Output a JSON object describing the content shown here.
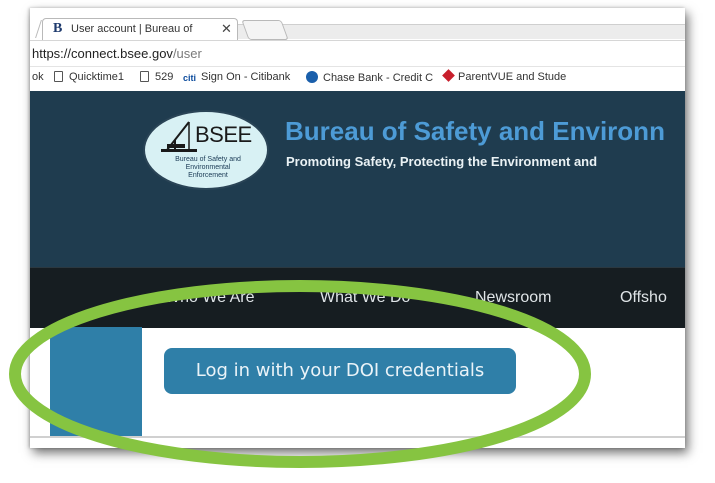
{
  "browser": {
    "tab": {
      "favicon_letter": "B",
      "title": "User account | Bureau of",
      "close_glyph": "✕"
    },
    "address": {
      "host": "https://connect.bsee.gov",
      "path": "/user"
    },
    "bookmarks": [
      {
        "label": "ok",
        "icon": "none"
      },
      {
        "label": "Quicktime1",
        "icon": "page-icon"
      },
      {
        "label": "529",
        "icon": "page-icon"
      },
      {
        "label": "Sign On - Citibank",
        "icon": "citi-icon",
        "icon_text": "citi"
      },
      {
        "label": "Chase Bank - Credit C",
        "icon": "chase-icon"
      },
      {
        "label": "ParentVUE and Stude",
        "icon": "parentvue-icon"
      }
    ]
  },
  "site": {
    "logo": {
      "acronym": "BSEE",
      "subtext_line1": "Bureau of Safety and",
      "subtext_line2": "Environmental",
      "subtext_line3": "Enforcement"
    },
    "title": "Bureau of Safety and Environn",
    "tagline": "Promoting Safety, Protecting the Environment and",
    "nav": [
      "Who We Are",
      "What We Do",
      "Newsroom",
      "Offsho"
    ]
  },
  "main": {
    "login_button": "Log in with your DOI credentials"
  },
  "colors": {
    "header_bg": "#1f3c4f",
    "nav_bg": "#161d21",
    "accent_blue": "#2f7fa8",
    "title_blue": "#4d9bd6",
    "highlight_green": "#86c441"
  }
}
